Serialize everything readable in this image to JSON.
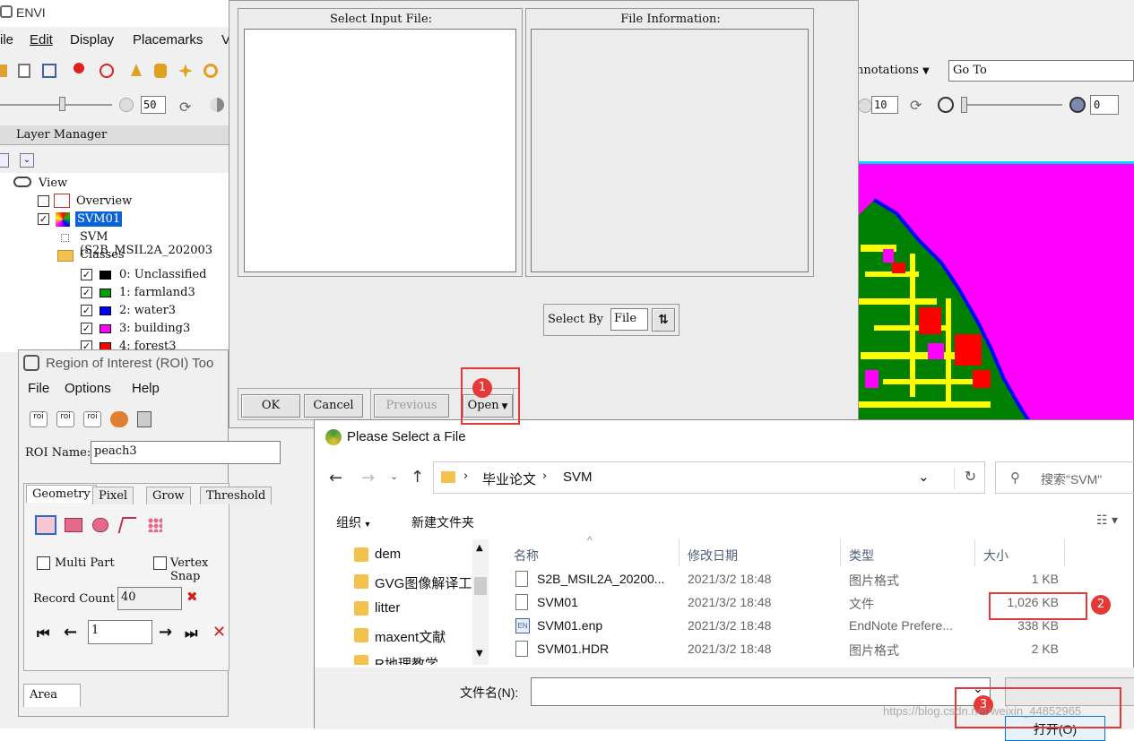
{
  "envi": {
    "title": "ENVI",
    "menu": [
      "ile",
      "Edit",
      "Display",
      "Placemarks",
      "V"
    ],
    "zoom_value": "50",
    "layer_manager": "Layer Manager",
    "annotations": "nnotations",
    "goto": "Go To",
    "zoom2": "10",
    "opacity": "0"
  },
  "tree": {
    "view": "View",
    "overview": "Overview",
    "svm01": "SVM01",
    "svm_source": "SVM (S2B_MSIL2A_202003",
    "classes": "Classes",
    "items": [
      {
        "label": "0: Unclassified",
        "color": "#000000"
      },
      {
        "label": "1: farmland3",
        "color": "#00a000"
      },
      {
        "label": "2: water3",
        "color": "#0000ff"
      },
      {
        "label": "3: building3",
        "color": "#ff00ff"
      },
      {
        "label": "4: forest3",
        "color": "#ff0000"
      }
    ]
  },
  "roi": {
    "title": "Region of Interest (ROI) Too",
    "menu": [
      "File",
      "Options",
      "Help"
    ],
    "name_label": "ROI Name:",
    "name_value": "peach3",
    "tabs": [
      "Geometry",
      "Pixel",
      "Grow",
      "Threshold"
    ],
    "multi_part": "Multi Part",
    "vertex_snap": "Vertex Snap",
    "record_count_label": "Record Count",
    "record_count": "40",
    "record_index": "1",
    "area_tab": "Area"
  },
  "select_dialog": {
    "input_header": "Select Input File:",
    "info_header": "File Information:",
    "select_by_label": "Select By",
    "select_by_value": "File",
    "ok": "OK",
    "cancel": "Cancel",
    "previous": "Previous",
    "open": "Open"
  },
  "file_dialog": {
    "title": "Please Select a File",
    "breadcrumb": [
      "毕业论文",
      "SVM"
    ],
    "search_placeholder": "搜索\"SVM\"",
    "organize": "组织",
    "new_folder": "新建文件夹",
    "folders": [
      "dem",
      "GVG图像解译工",
      "litter",
      "maxent文献",
      "R地理教学"
    ],
    "columns": [
      "名称",
      "修改日期",
      "类型",
      "大小"
    ],
    "files": [
      {
        "name": "S2B_MSIL2A_20200...",
        "date": "2021/3/2 18:48",
        "type": "图片格式",
        "size": "1 KB",
        "icon": "file-icon"
      },
      {
        "name": "SVM01",
        "date": "2021/3/2 18:48",
        "type": "文件",
        "size": "1,026 KB",
        "icon": "file-icon"
      },
      {
        "name": "SVM01.enp",
        "date": "2021/3/2 18:48",
        "type": "EndNote Prefere...",
        "size": "338 KB",
        "icon": "endnote-icon"
      },
      {
        "name": "SVM01.HDR",
        "date": "2021/3/2 18:48",
        "type": "图片格式",
        "size": "2 KB",
        "icon": "file-icon"
      }
    ],
    "filename_label": "文件名(N):",
    "filename_value": "",
    "open_button": "打开(O)"
  },
  "annotations": {
    "step1": "1",
    "step2": "2",
    "step3": "3",
    "color": "#e53935"
  },
  "watermark": "https://blog.csdn.net/weixin_44852965"
}
